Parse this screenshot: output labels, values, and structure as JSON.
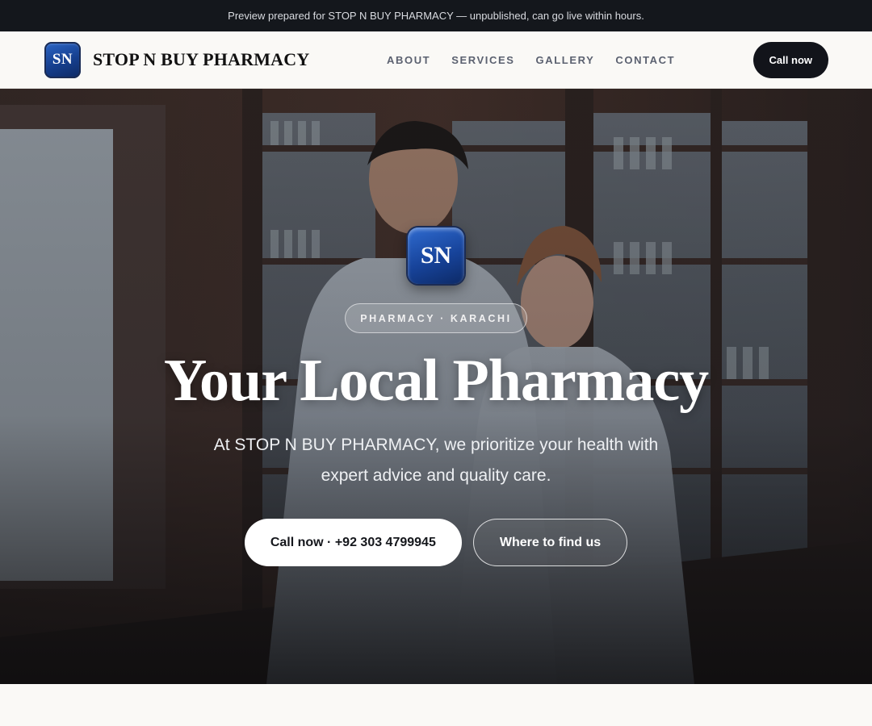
{
  "topbar": {
    "text": "Preview prepared for STOP N BUY PHARMACY — unpublished, can go live within hours."
  },
  "brand": {
    "logo_text": "SN",
    "name": "STOP N BUY PHARMACY"
  },
  "nav": {
    "items": [
      {
        "label": "ABOUT"
      },
      {
        "label": "SERVICES"
      },
      {
        "label": "GALLERY"
      },
      {
        "label": "CONTACT"
      }
    ],
    "cta_label": "Call now"
  },
  "hero": {
    "logo_text": "SN",
    "eyebrow": "PHARMACY · KARACHI",
    "title": "Your Local Pharmacy",
    "subtitle": "At STOP N BUY PHARMACY, we prioritize your health with expert advice and quality care.",
    "primary_button": "Call now · +92 303 4799945",
    "secondary_button": "Where to find us",
    "background_image": "two pharmacists in white coats in front of wooden medicine cabinets"
  },
  "colors": {
    "dark": "#12141a",
    "logo_blue": "#17439a",
    "page_bg": "#faf9f6"
  }
}
